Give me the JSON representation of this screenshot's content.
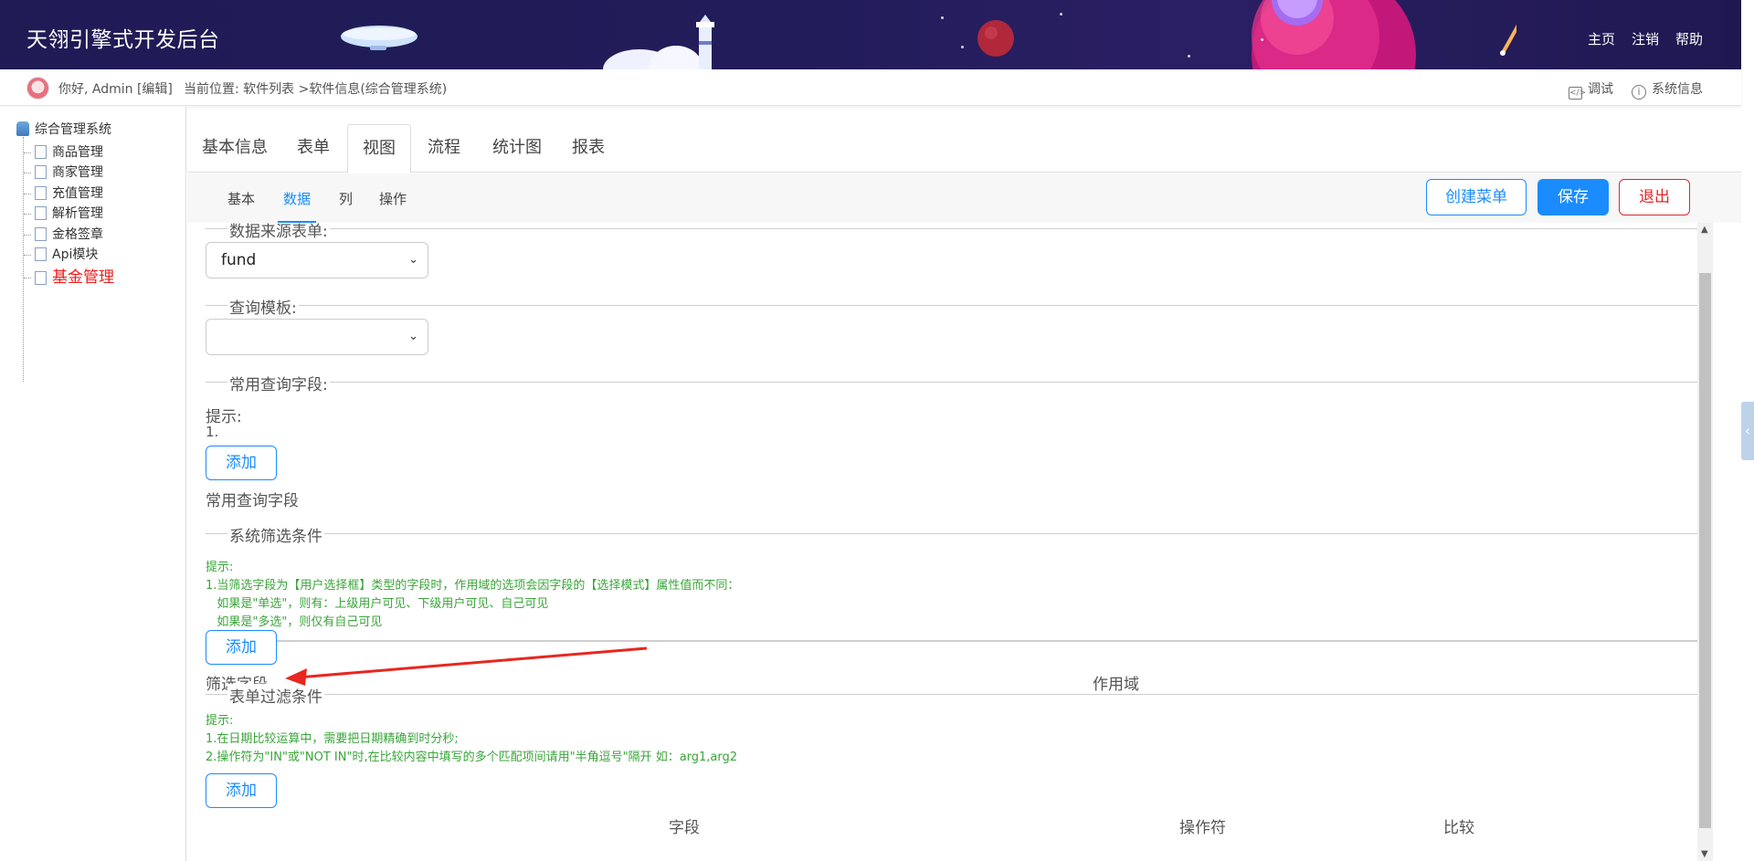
{
  "header": {
    "title": "天翎引擎式开发后台",
    "nav": [
      "主页",
      "注销",
      "帮助"
    ]
  },
  "subbar": {
    "greeting": "你好, Admin [编辑]",
    "breadcrumb": "当前位置: 软件列表 >软件信息(综合管理系统)",
    "debug_label": "调试",
    "sysinfo_label": "系统信息"
  },
  "tree": {
    "root": "综合管理系统",
    "items": [
      "商品管理",
      "商家管理",
      "充值管理",
      "解析管理",
      "金格签章",
      "Api模块",
      "基金管理"
    ]
  },
  "tabs": [
    "基本信息",
    "表单",
    "视图",
    "流程",
    "统计图",
    "报表"
  ],
  "subtabs": [
    "基本",
    "数据",
    "列",
    "操作"
  ],
  "actions": {
    "create_menu": "创建菜单",
    "save": "保存",
    "exit": "退出"
  },
  "content": {
    "datasource_legend": "数据来源表单:",
    "datasource_value": "fund",
    "query_template_legend": "查询模板:",
    "query_template_value": "",
    "common_query_legend": "常用查询字段:",
    "common_hint_title": "提示:",
    "common_hint_1": "1.",
    "add_label": "添加",
    "common_query_field": "常用查询字段",
    "sys_filter_legend": "系统筛选条件",
    "sys_hint": "提示:\n1.当筛选字段为【用户选择框】类型的字段时，作用域的选项会因字段的【选择模式】属性值而不同：\n   如果是\"单选\"，则有：上级用户可见、下级用户可见、自己可见\n   如果是\"多选\"，则仅有自己可见",
    "filter_field": "筛选字段",
    "scope": "作用域",
    "form_filter_legend": "表单过滤条件",
    "form_hint": "提示:\n1.在日期比较运算中，需要把日期精确到时分秒;\n2.操作符为\"IN\"或\"NOT IN\"时,在比较内容中填写的多个匹配项间请用\"半角逗号\"隔开 如：arg1,arg2",
    "col_field": "字段",
    "col_operator": "操作符",
    "col_compare": "比较"
  },
  "colors": {
    "accent": "#1a8cff",
    "danger": "#e0272a",
    "hint": "#3aa53a",
    "banner": "#1f1b55",
    "annotation_arrow": "#e8271f"
  }
}
